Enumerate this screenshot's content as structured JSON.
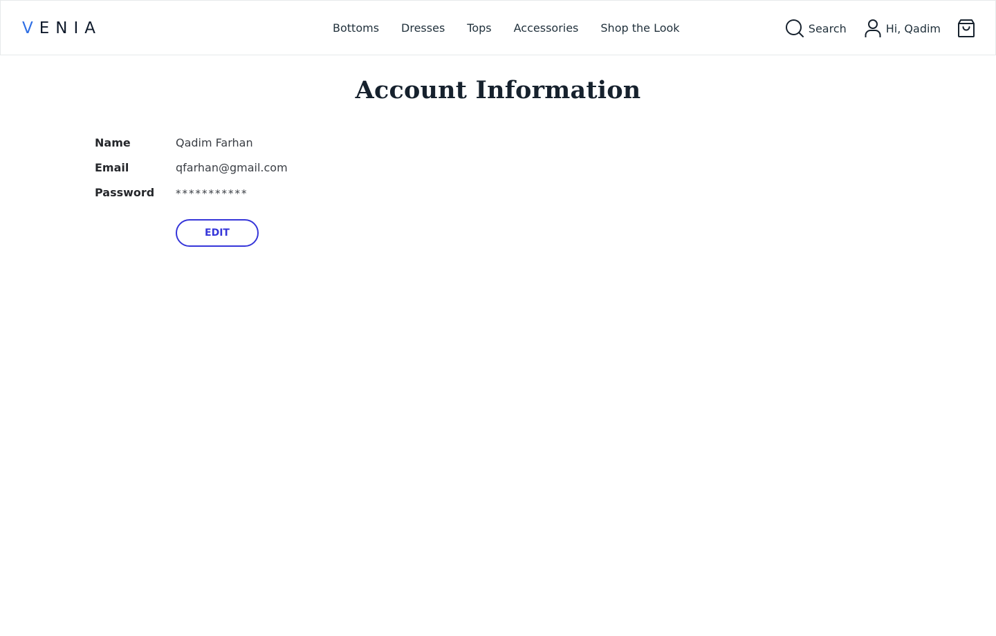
{
  "header": {
    "logo": {
      "accent_letter": "V",
      "rest": "ENIA"
    },
    "nav": [
      {
        "label": "Bottoms"
      },
      {
        "label": "Dresses"
      },
      {
        "label": "Tops"
      },
      {
        "label": "Accessories"
      },
      {
        "label": "Shop the Look"
      }
    ],
    "search_label": "Search",
    "account_label": "Hi, Qadim",
    "icons": {
      "search": "search-icon",
      "account": "user-icon",
      "cart": "shopping-bag-icon"
    }
  },
  "page": {
    "title": "Account Information"
  },
  "account": {
    "fields": [
      {
        "label": "Name",
        "value": "Qadim Farhan"
      },
      {
        "label": "Email",
        "value": "qfarhan@gmail.com"
      },
      {
        "label": "Password",
        "value": "***********"
      }
    ],
    "edit_label": "EDIT"
  },
  "colors": {
    "accent": "#3535d9",
    "logo_accent": "#2f6fe4",
    "text_dark": "#16212d"
  }
}
